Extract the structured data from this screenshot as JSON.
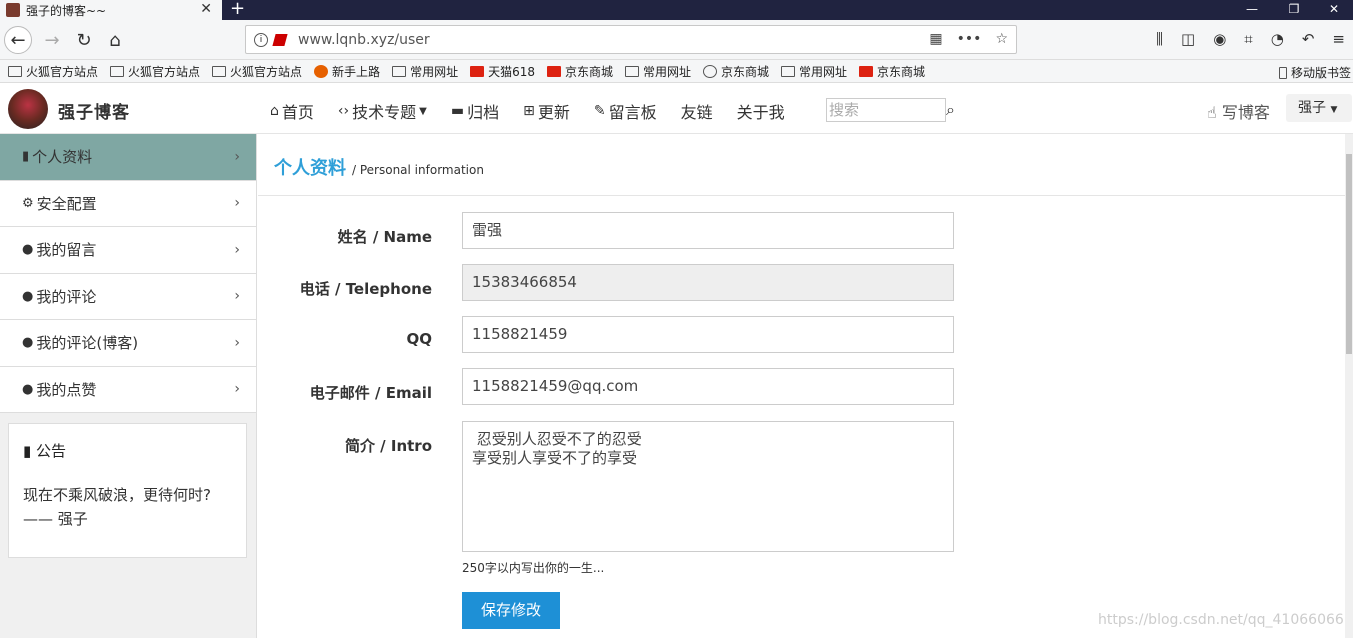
{
  "browser": {
    "tab_title": "强子的博客~~",
    "new_tab": "+",
    "url_host": "www.lqnb.xyz",
    "url_path": "/user",
    "bookmarks": [
      {
        "label": "火狐官方站点",
        "icon": "folder"
      },
      {
        "label": "火狐官方站点",
        "icon": "folder"
      },
      {
        "label": "火狐官方站点",
        "icon": "folder"
      },
      {
        "label": "新手上路",
        "icon": "firefox"
      },
      {
        "label": "常用网址",
        "icon": "folder"
      },
      {
        "label": "天猫618",
        "icon": "tmall"
      },
      {
        "label": "京东商城",
        "icon": "jd"
      },
      {
        "label": "常用网址",
        "icon": "folder"
      },
      {
        "label": "京东商城",
        "icon": "globe"
      },
      {
        "label": "常用网址",
        "icon": "folder"
      },
      {
        "label": "京东商城",
        "icon": "jd"
      }
    ],
    "mobile_bookmarks": "移动版书签"
  },
  "header": {
    "logo_text": "强子博客",
    "nav": [
      {
        "label": "首页",
        "icon": "home-icon"
      },
      {
        "label": "技术专题",
        "icon": "code-icon"
      },
      {
        "label": "归档",
        "icon": "archive-icon"
      },
      {
        "label": "更新",
        "icon": "calendar-plus-icon"
      },
      {
        "label": "留言板",
        "icon": "pencil-icon"
      },
      {
        "label": "友链",
        "icon": ""
      },
      {
        "label": "关于我",
        "icon": ""
      }
    ],
    "search_placeholder": "搜索",
    "write_blog": "写博客",
    "user": "强子"
  },
  "sidebar": {
    "items": [
      {
        "label": "个人资料",
        "icon": "file-icon",
        "active": true
      },
      {
        "label": "安全配置",
        "icon": "gear-icon",
        "active": false
      },
      {
        "label": "我的留言",
        "icon": "comment-icon",
        "active": false
      },
      {
        "label": "我的评论",
        "icon": "comments-icon",
        "active": false
      },
      {
        "label": "我的评论(博客)",
        "icon": "comments-icon",
        "active": false
      },
      {
        "label": "我的点赞",
        "icon": "comments-icon",
        "active": false
      }
    ],
    "notice": {
      "title": "公告",
      "line1": "现在不乘风破浪，更待何时?",
      "line2": "—— 强子"
    }
  },
  "main": {
    "title": "个人资料",
    "subtitle": "/ Personal information",
    "fields": {
      "name_label": "姓名 / Name",
      "name_value": "雷强",
      "phone_label": "电话 / Telephone",
      "phone_value": "15383466854",
      "qq_label": "QQ",
      "qq_value": "1158821459",
      "email_label": "电子邮件 / Email",
      "email_value": "1158821459@qq.com",
      "intro_label": "简介 / Intro",
      "intro_value": " 忍受别人忍受不了的忍受\n享受别人享受不了的享受"
    },
    "hint": "250字以内写出你的一生...",
    "save": "保存修改"
  },
  "watermark": "https://blog.csdn.net/qq_41066066",
  "colors": {
    "accent": "#1e90d6",
    "title": "#2f9fd8",
    "sidebar_active": "#7fa7a3"
  }
}
